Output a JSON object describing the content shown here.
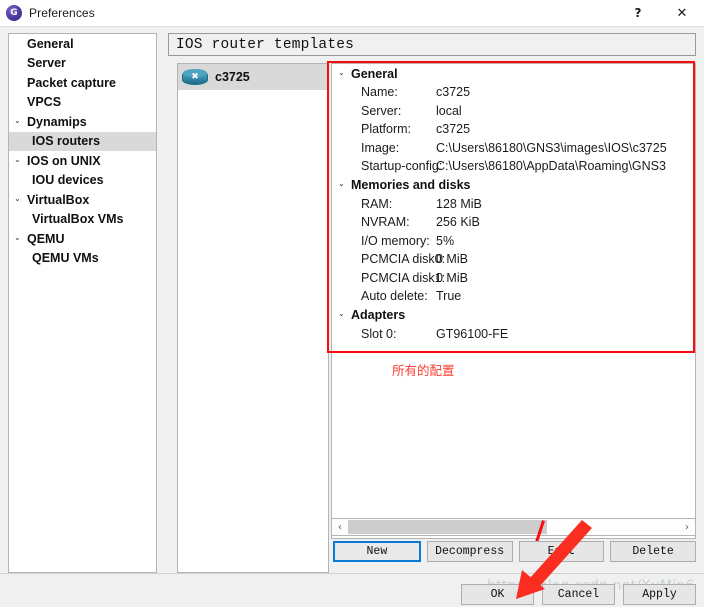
{
  "window": {
    "title": "Preferences",
    "icon": "gns3-logo-icon",
    "help_label": "?",
    "close_label": "✕"
  },
  "sidebar": {
    "items": [
      {
        "label": "General",
        "level": 0,
        "caret": "",
        "selected": false
      },
      {
        "label": "Server",
        "level": 0,
        "caret": "",
        "selected": false
      },
      {
        "label": "Packet capture",
        "level": 0,
        "caret": "",
        "selected": false
      },
      {
        "label": "VPCS",
        "level": 0,
        "caret": "",
        "selected": false
      },
      {
        "label": "Dynamips",
        "level": 0,
        "caret": "⌄",
        "selected": false
      },
      {
        "label": "IOS routers",
        "level": 1,
        "caret": "",
        "selected": true
      },
      {
        "label": "IOS on UNIX",
        "level": 0,
        "caret": "⌄",
        "selected": false
      },
      {
        "label": "IOU devices",
        "level": 1,
        "caret": "",
        "selected": false
      },
      {
        "label": "VirtualBox",
        "level": 0,
        "caret": "⌄",
        "selected": false
      },
      {
        "label": "VirtualBox VMs",
        "level": 1,
        "caret": "",
        "selected": false
      },
      {
        "label": "QEMU",
        "level": 0,
        "caret": "⌄",
        "selected": false
      },
      {
        "label": "QEMU VMs",
        "level": 1,
        "caret": "",
        "selected": false
      }
    ]
  },
  "main": {
    "header_title": "IOS router templates",
    "template_list": [
      {
        "name": "c3725",
        "icon": "router-icon",
        "selected": true
      }
    ],
    "properties": [
      {
        "type": "group",
        "label": "General",
        "caret": "⌄"
      },
      {
        "type": "row",
        "key": "Name:",
        "value": "c3725"
      },
      {
        "type": "row",
        "key": "Server:",
        "value": "local"
      },
      {
        "type": "row",
        "key": "Platform:",
        "value": "c3725"
      },
      {
        "type": "row",
        "key": "Image:",
        "value": "C:\\Users\\86180\\GNS3\\images\\IOS\\c3725"
      },
      {
        "type": "row",
        "key": "Startup-config:",
        "value": "C:\\Users\\86180\\AppData\\Roaming\\GNS3"
      },
      {
        "type": "group",
        "label": "Memories and disks",
        "caret": "⌄"
      },
      {
        "type": "row",
        "key": "RAM:",
        "value": "128 MiB"
      },
      {
        "type": "row",
        "key": "NVRAM:",
        "value": "256 KiB"
      },
      {
        "type": "row",
        "key": "I/O memory:",
        "value": "5%"
      },
      {
        "type": "row",
        "key": "PCMCIA disk0:",
        "value": "0 MiB"
      },
      {
        "type": "row",
        "key": "PCMCIA disk1:",
        "value": "0 MiB"
      },
      {
        "type": "row",
        "key": "Auto delete:",
        "value": "True"
      },
      {
        "type": "group",
        "label": "Adapters",
        "caret": "⌄"
      },
      {
        "type": "row",
        "key": "Slot 0:",
        "value": "GT96100-FE"
      }
    ],
    "scrollbar": {
      "left_arrow": "‹",
      "right_arrow": "›",
      "thumb_percent": 60
    },
    "action_buttons": [
      {
        "label": "New",
        "focused": true
      },
      {
        "label": "Decompress",
        "focused": false
      },
      {
        "label": "Edit",
        "focused": false
      },
      {
        "label": "Delete",
        "focused": false
      }
    ]
  },
  "footer": {
    "buttons": [
      {
        "label": "OK"
      },
      {
        "label": "Cancel"
      },
      {
        "label": "Apply"
      }
    ]
  },
  "annotations": {
    "chinese_note": "所有的配置",
    "watermark": "https://blog.csdn.net/XuMin6",
    "highlight_color": "#fb0c0c",
    "arrow_color": "#fb2c20"
  }
}
